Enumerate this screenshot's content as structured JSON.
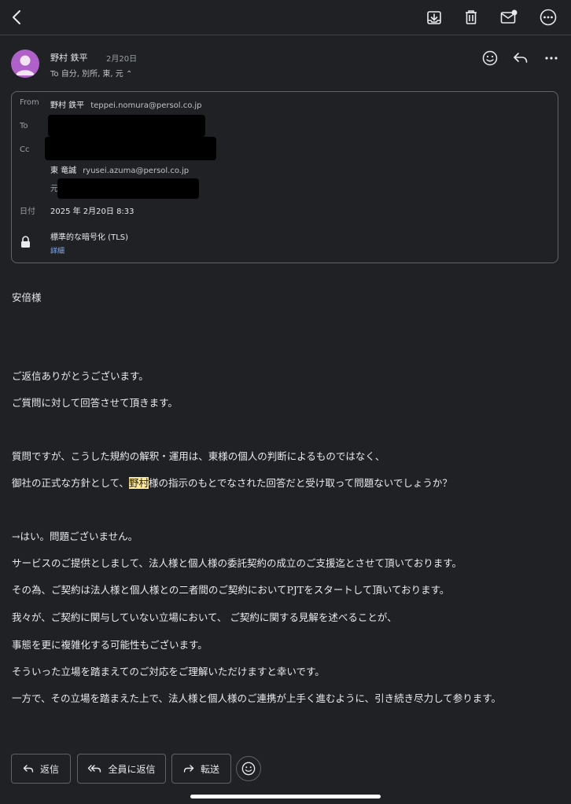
{
  "toolbar": {
    "icons": [
      "back-icon",
      "archive-icon",
      "trash-icon",
      "mark-unread-icon",
      "more-icon"
    ]
  },
  "sender": {
    "name": "野村 鉄平",
    "date": "2月20日",
    "to_line": "To 自分, 別所, 東, 元 ⌃"
  },
  "details": {
    "from_label": "From",
    "from_name": "野村 鉄平",
    "from_email": "teppei.nomura@persol.co.jp",
    "to_label": "To",
    "cc_label": "Cc",
    "cc_name": "東 竜誠",
    "cc_email": "ryusei.azuma@persol.co.jp",
    "cc_partial": "元",
    "date_label": "日付",
    "date_value": "2025 年 2月20日 8:33",
    "encryption": "標準的な暗号化 (TLS)",
    "details_link": "詳細"
  },
  "body": {
    "greeting": "安倍様",
    "line1": "ご返信ありがとうございます。",
    "line2": "ご質問に対して回答させて頂きます。",
    "question1": "質問ですが、こうした規約の解釈・運用は、東様の個人の判断によるものではなく、",
    "question2_pre": "御社の正式な方針として、",
    "question2_hl": "野村",
    "question2_post": "様の指示のもとでなされた回答だと受け取って問題ないでしょうか？",
    "answer1": "→はい。問題ございません。",
    "answer2": "サービスのご提供としまして、法人様と個人様の委託契約の成立のご支援迄とさせて頂いております。",
    "answer3": "その為、ご契約は法人様と個人様との二者間のご契約においてPJTをスタートして頂いております。",
    "answer4": "我々が、ご契約に関与していない立場において、 ご契約に関する見解を述べることが、",
    "answer5": "事態を更に複雑化する可能性もございます。",
    "answer6": "そういった立場を踏まえてのご対応をご理解いただけますと幸いです。",
    "answer7": "一方で、その立場を踏まえた上で、法人様と個人様のご連携が上手く進むように、引き続き尽力して参ります。"
  },
  "actions": {
    "reply": "返信",
    "reply_all": "全員に返信",
    "forward": "転送"
  }
}
